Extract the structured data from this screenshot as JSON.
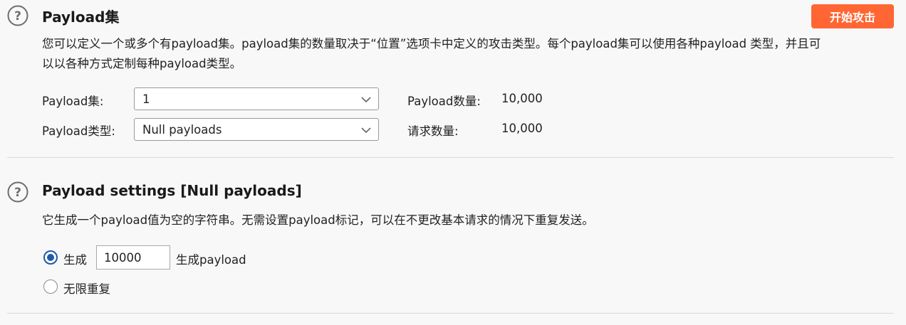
{
  "payload_sets": {
    "title": "Payload集",
    "description_line1": "您可以定义一个或多个有payload集。payload集的数量取决于“位置”选项卡中定义的攻击类型。每个payload集可以使用各种payload 类型，并且可",
    "description_line2": "以以各种方式定制每种payload类型。",
    "start_attack_label": "开始攻击",
    "payload_set_label": "Payload集:",
    "payload_set_value": "1",
    "payload_type_label": "Payload类型:",
    "payload_type_value": "Null payloads",
    "payload_count_label": "Payload数量:",
    "payload_count_value": "10,000",
    "request_count_label": "请求数量:",
    "request_count_value": "10,000"
  },
  "payload_settings": {
    "title": "Payload settings [Null payloads]",
    "description": "它生成一个payload值为空的字符串。无需设置payload标记，可以在不更改基本请求的情况下重复发送。",
    "generate_label": "生成",
    "generate_value": "10000",
    "generate_suffix": "生成payload",
    "generate_selected": true,
    "repeat_label": "无限重复",
    "repeat_selected": false
  },
  "icons": [
    "help-icon",
    "chevron-down-icon"
  ],
  "colors": {
    "accent_button": "#ff6633",
    "radio_selected": "#1e5aa8",
    "background": "#f8f8f8"
  }
}
